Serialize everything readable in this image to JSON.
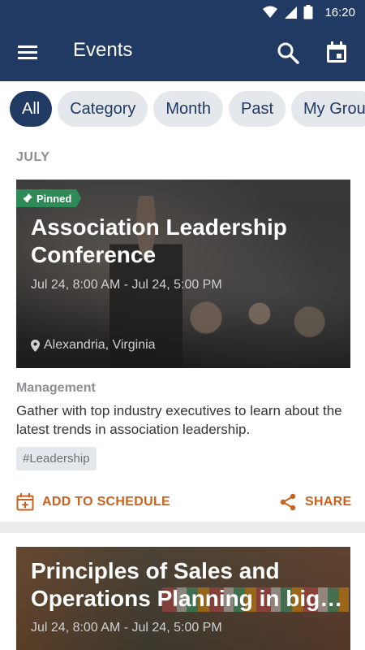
{
  "status_bar": {
    "time": "16:20"
  },
  "app_bar": {
    "title": "Events"
  },
  "filters": [
    "All",
    "Category",
    "Month",
    "Past",
    "My Grou"
  ],
  "month_label": "JULY",
  "events": [
    {
      "pinned_label": "Pinned",
      "title": "Association Leadership Conference",
      "date": "Jul 24, 8:00 AM - Jul 24, 5:00 PM",
      "location": "Alexandria, Virginia",
      "category": "Management",
      "description": "Gather with top industry executives to learn about the latest trends in association leadership.",
      "tag": "#Leadership",
      "add_to_schedule": "ADD TO SCHEDULE",
      "share": "SHARE"
    },
    {
      "title": "Principles of Sales and Operations Planning in big…",
      "date": "Jul 24, 8:00 AM - Jul 24, 5:00 PM"
    }
  ],
  "colors": {
    "primary": "#213a64",
    "accent": "#c8621f",
    "pinned": "#2e8b57",
    "chip_bg": "#e4e8ed"
  },
  "icons": [
    "wifi-icon",
    "signal-icon",
    "battery-icon",
    "menu-icon",
    "search-icon",
    "calendar-icon",
    "pin-icon",
    "location-icon",
    "calendar-add-icon",
    "share-icon"
  ]
}
